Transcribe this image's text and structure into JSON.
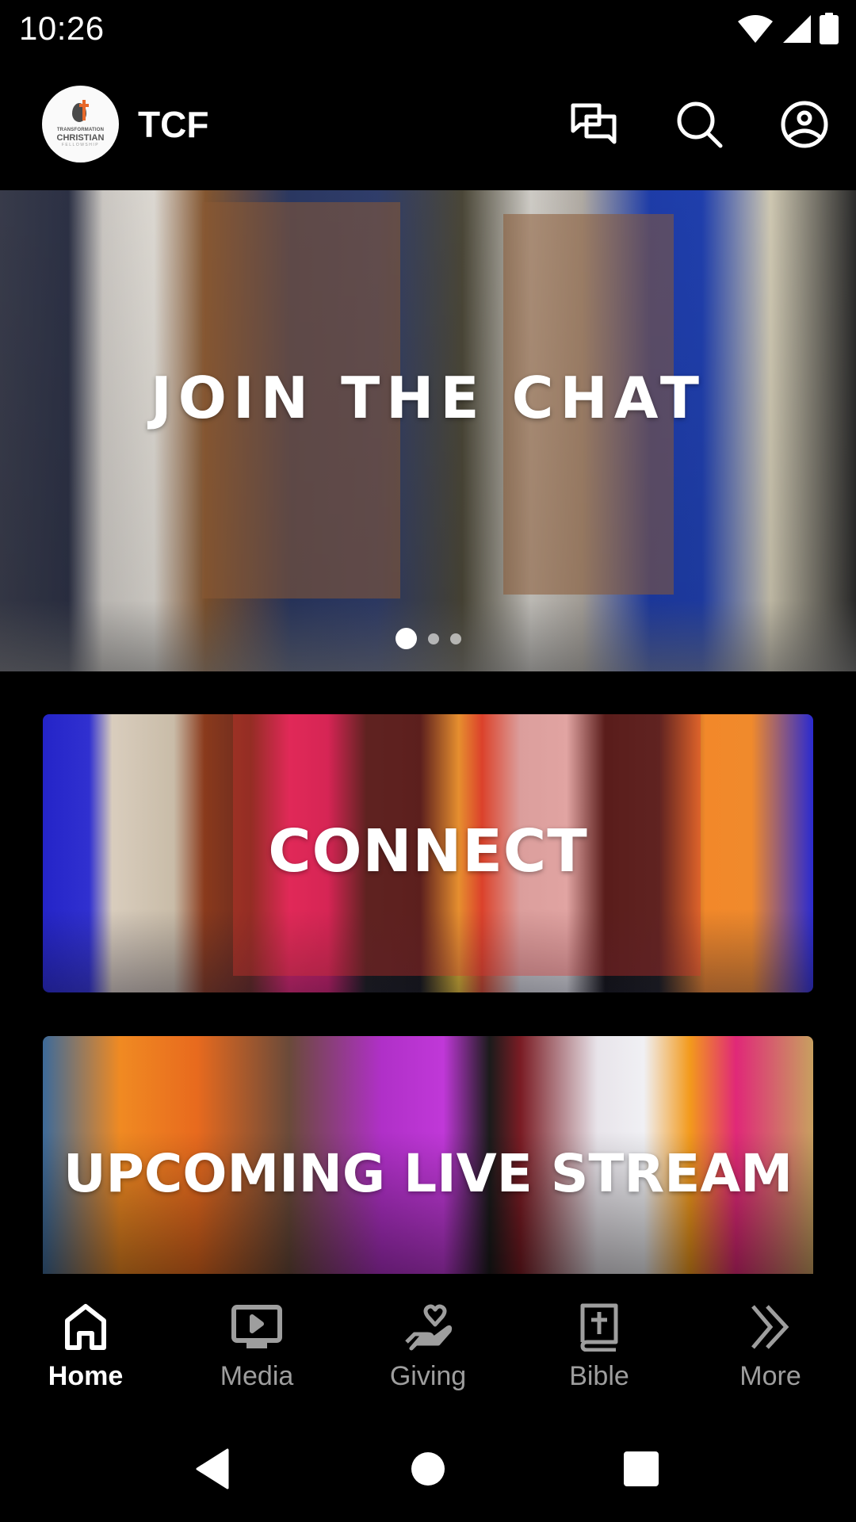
{
  "status_bar": {
    "time": "10:26",
    "icons": [
      "wifi-icon",
      "cellular-signal-icon",
      "battery-icon"
    ]
  },
  "app_bar": {
    "logo": {
      "line1": "TRANSFORMATION",
      "line2": "CHRISTIAN",
      "line3": "FELLOWSHIP"
    },
    "title": "TCF",
    "actions": [
      {
        "name": "chat",
        "icon": "chat-bubbles-icon"
      },
      {
        "name": "search",
        "icon": "search-icon"
      },
      {
        "name": "profile",
        "icon": "account-circle-icon"
      }
    ]
  },
  "hero_carousel": {
    "title": "JOIN THE CHAT",
    "slide_count": 3,
    "active_slide": 1
  },
  "cards": [
    {
      "title": "CONNECT"
    },
    {
      "title": "UPCOMING LIVE STREAM"
    }
  ],
  "bottom_nav": {
    "items": [
      {
        "label": "Home",
        "icon": "home-icon",
        "active": true
      },
      {
        "label": "Media",
        "icon": "media-play-icon",
        "active": false
      },
      {
        "label": "Giving",
        "icon": "giving-hand-heart-icon",
        "active": false
      },
      {
        "label": "Bible",
        "icon": "bible-icon",
        "active": false
      },
      {
        "label": "More",
        "icon": "double-chevron-right-icon",
        "active": false
      }
    ]
  },
  "colors": {
    "background": "#000000",
    "active_nav": "#ffffff",
    "inactive_nav": "#9e9e9e",
    "logo_accent": "#e8692a"
  }
}
